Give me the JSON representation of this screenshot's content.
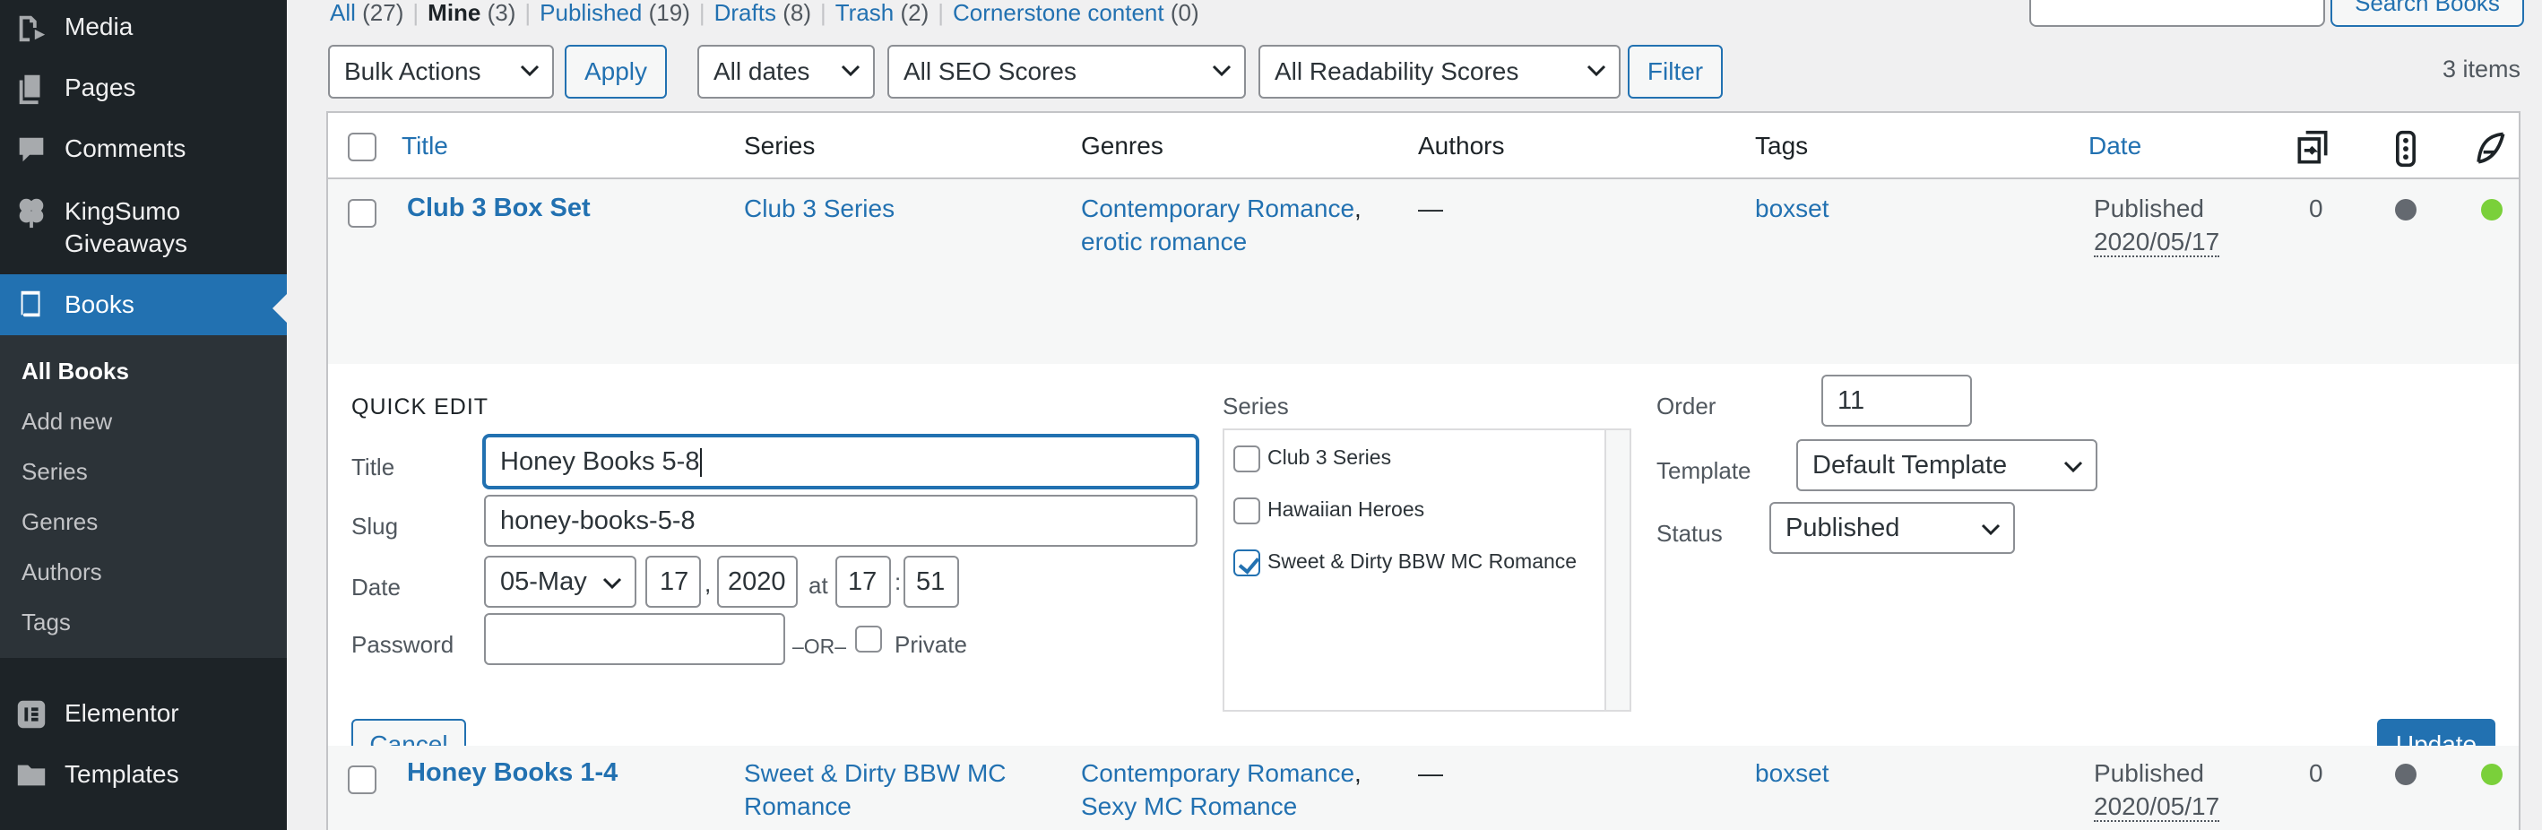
{
  "sidebar": {
    "items": [
      {
        "label": "Media",
        "icon": "media-icon"
      },
      {
        "label": "Pages",
        "icon": "pages-icon"
      },
      {
        "label": "Comments",
        "icon": "comments-icon"
      },
      {
        "label": "KingSumo Giveaways",
        "icon": "clover-icon"
      },
      {
        "label": "Books",
        "icon": "book-icon"
      },
      {
        "label": "Elementor",
        "icon": "elementor-icon"
      },
      {
        "label": "Templates",
        "icon": "folder-icon"
      }
    ],
    "kingsumo_line1": "KingSumo",
    "kingsumo_line2": "Giveaways",
    "submenu": [
      "All Books",
      "Add new",
      "Series",
      "Genres",
      "Authors",
      "Tags"
    ],
    "accent": "#2271b1"
  },
  "views": {
    "all": "All",
    "all_count": "(27)",
    "mine": "Mine",
    "mine_count": "(3)",
    "published": "Published",
    "published_count": "(19)",
    "drafts": "Drafts",
    "drafts_count": "(8)",
    "trash": "Trash",
    "trash_count": "(2)",
    "cornerstone": "Cornerstone content",
    "cornerstone_count": "(0)",
    "sep": "|"
  },
  "search": {
    "button": "Search Books",
    "value": ""
  },
  "toolbar": {
    "bulk_actions": "Bulk Actions",
    "apply": "Apply",
    "dates": "All dates",
    "seo": "All SEO Scores",
    "readability": "All Readability Scores",
    "filter": "Filter",
    "items_count": "3 items"
  },
  "table": {
    "columns": {
      "title": "Title",
      "series": "Series",
      "genres": "Genres",
      "authors": "Authors",
      "tags": "Tags",
      "date": "Date"
    },
    "rows": [
      {
        "title": "Club 3 Box Set",
        "series": "Club 3 Series",
        "genre1": "Contemporary Romance",
        "genre2": "erotic romance",
        "comma": ",",
        "authors": "—",
        "tags": "boxset",
        "status": "Published",
        "date": "2020/05/17",
        "count": "0"
      },
      {
        "title": "Honey Books 1-4",
        "series1": "Sweet & Dirty BBW MC",
        "series2": "Romance",
        "genre1": "Contemporary Romance",
        "genre2": "Sexy MC Romance",
        "comma": ",",
        "authors": "—",
        "tags": "boxset",
        "status": "Published",
        "date": "2020/05/17",
        "count": "0"
      }
    ],
    "status_colors": {
      "seo": "#646970",
      "readability": "#7ad03a"
    }
  },
  "quick_edit": {
    "heading": "QUICK EDIT",
    "title_label": "Title",
    "title_value": "Honey Books 5-8",
    "slug_label": "Slug",
    "slug_value": "honey-books-5-8",
    "date_label": "Date",
    "month": "05-May",
    "day": "17",
    "comma": ",",
    "year": "2020",
    "at": "at",
    "hour": "17",
    "colon": ":",
    "minute": "51",
    "password_label": "Password",
    "password_value": "",
    "or": "–OR–",
    "private": "Private",
    "series_label": "Series",
    "series_options": [
      {
        "label": "Club 3 Series",
        "checked": false
      },
      {
        "label": "Hawaiian Heroes",
        "checked": false
      },
      {
        "label": "Sweet & Dirty BBW MC Romance",
        "checked": true
      }
    ],
    "order_label": "Order",
    "order_value": "11",
    "template_label": "Template",
    "template_value": "Default Template",
    "status_label": "Status",
    "status_value": "Published",
    "cancel": "Cancel",
    "update": "Update"
  }
}
